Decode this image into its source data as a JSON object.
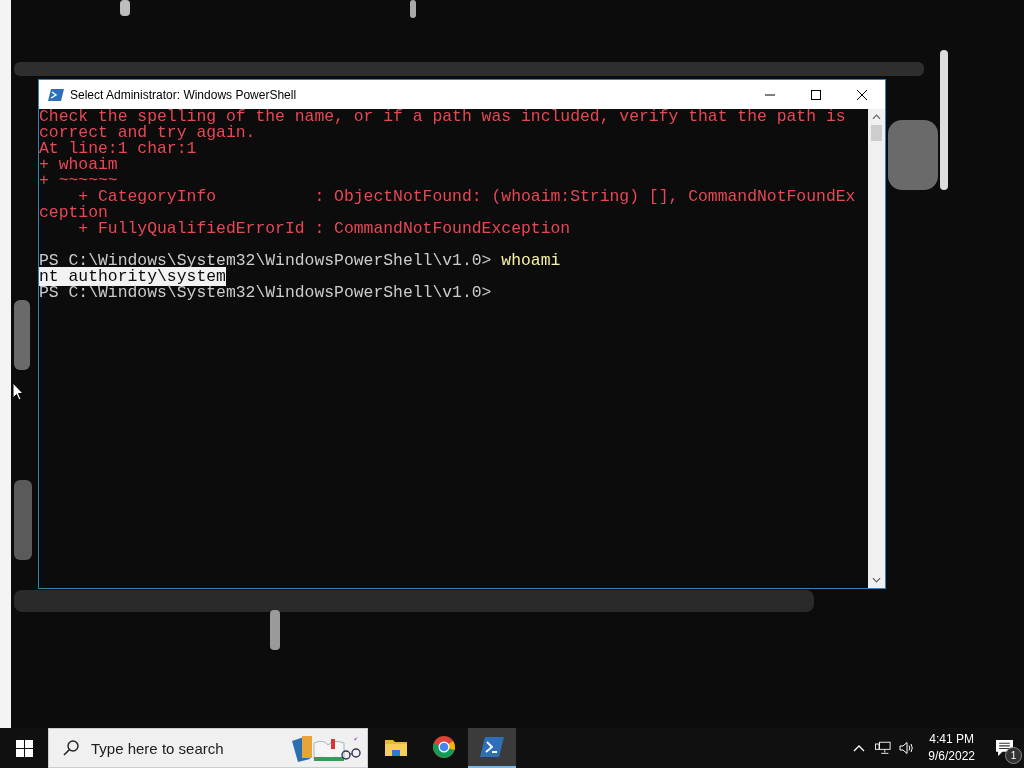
{
  "window": {
    "title": "Select Administrator: Windows PowerShell",
    "focused": true
  },
  "console": {
    "lines": [
      {
        "kind": "text",
        "segments": [
          {
            "kind": "error",
            "text": "Check the spelling of the name, or if a path was included, verify that the path is"
          }
        ]
      },
      {
        "kind": "text",
        "segments": [
          {
            "kind": "error",
            "text": "correct and try again."
          }
        ]
      },
      {
        "kind": "text",
        "segments": [
          {
            "kind": "error",
            "text": "At line:1 char:1"
          }
        ]
      },
      {
        "kind": "text",
        "segments": [
          {
            "kind": "error",
            "text": "+ whoaim"
          }
        ]
      },
      {
        "kind": "text",
        "segments": [
          {
            "kind": "error",
            "text": "+ ~~~~~~"
          }
        ]
      },
      {
        "kind": "text",
        "segments": [
          {
            "kind": "error",
            "text": "    + CategoryInfo          : ObjectNotFound: (whoaim:String) [], CommandNotFoundEx"
          }
        ]
      },
      {
        "kind": "text",
        "segments": [
          {
            "kind": "error",
            "text": "ception"
          }
        ]
      },
      {
        "kind": "text",
        "segments": [
          {
            "kind": "error",
            "text": "    + FullyQualifiedErrorId : CommandNotFoundException"
          }
        ]
      },
      {
        "kind": "blank"
      },
      {
        "kind": "text",
        "segments": [
          {
            "kind": "output",
            "text": "PS C:\\Windows\\System32\\WindowsPowerShell\\v1.0> "
          },
          {
            "kind": "command",
            "text": "whoami"
          }
        ]
      },
      {
        "kind": "text",
        "segments": [
          {
            "kind": "selected",
            "text": "nt authority\\system"
          }
        ]
      },
      {
        "kind": "text",
        "segments": [
          {
            "kind": "output",
            "text": "PS C:\\Windows\\System32\\WindowsPowerShell\\v1.0>"
          }
        ]
      }
    ]
  },
  "taskbar": {
    "search": {
      "placeholder": "Type here to search"
    },
    "apps": [
      {
        "kind": "files",
        "selected": false
      },
      {
        "kind": "browser",
        "selected": false
      },
      {
        "kind": "powershell",
        "selected": true
      }
    ],
    "clock": {
      "time": "4:41 PM",
      "date": "9/6/2022"
    },
    "notifications": {
      "count": "1"
    }
  }
}
